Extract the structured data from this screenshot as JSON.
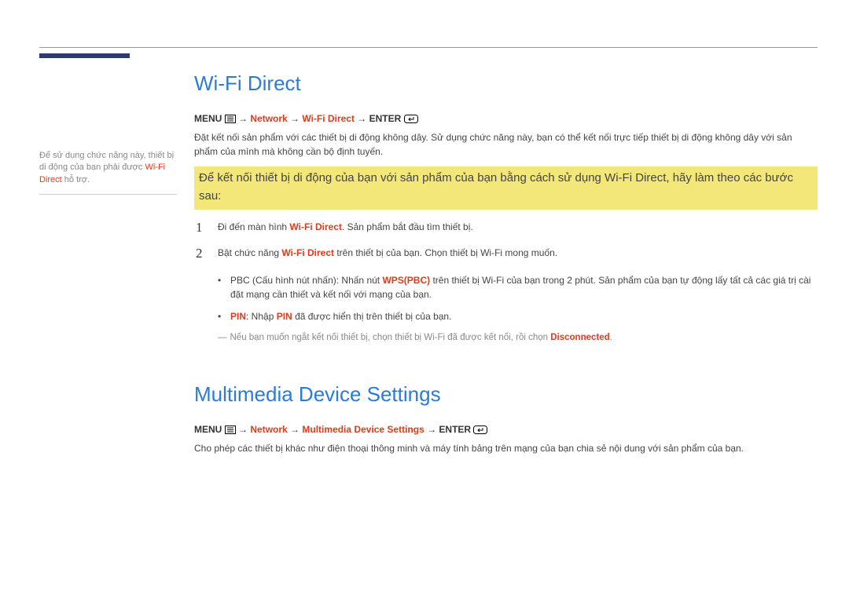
{
  "sidebar": {
    "note_pre": "Để sử dụng chức năng này, thiết bị di động của bạn phải được ",
    "note_hl": "Wi-Fi Direct",
    "note_post": " hỗ trợ."
  },
  "section1": {
    "title": "Wi-Fi Direct",
    "nav": {
      "menu": "MENU",
      "network": "Network",
      "item": "Wi-Fi Direct",
      "enter": "ENTER"
    },
    "intro": "Đặt kết nối sản phẩm với các thiết bị di động không dây. Sử dụng chức năng này, bạn có thể kết nối trực tiếp thiết bị di động không dây với sản phẩm của mình mà không cần bộ định tuyến.",
    "highlight": "Để kết nối thiết bị di động của bạn với sản phẩm của bạn bằng cách sử dụng Wi-Fi Direct, hãy làm theo các bước sau:",
    "step1_pre": "Đi đến màn hình ",
    "step1_hl": "Wi-Fi Direct",
    "step1_post": ". Sản phẩm bắt đầu tìm thiết bị.",
    "step2_pre": "Bật chức năng ",
    "step2_hl": "Wi-Fi Direct",
    "step2_post": " trên thiết bị của bạn. Chọn thiết bị Wi-Fi mong muốn.",
    "bullet1_pre": "PBC (Cấu hình nút nhấn): Nhấn nút ",
    "bullet1_hl": "WPS(PBC)",
    "bullet1_post": " trên thiết bị Wi-Fi của bạn trong 2 phút. Sản phẩm của bạn tự động lấy tất cả các giá trị cài đặt mạng cần thiết và kết nối với mạng của bạn.",
    "bullet2_hl1": "PIN",
    "bullet2_mid": ": Nhập ",
    "bullet2_hl2": "PIN",
    "bullet2_post": " đã được hiển thị trên thiết bị của bạn.",
    "footnote_pre": "Nếu bạn muốn ngắt kết nối thiết bị, chọn thiết bị Wi-Fi đã được kết nối, rồi chọn ",
    "footnote_hl": "Disconnected",
    "footnote_post": "."
  },
  "section2": {
    "title": "Multimedia Device Settings",
    "nav": {
      "menu": "MENU",
      "network": "Network",
      "item": "Multimedia Device Settings",
      "enter": "ENTER"
    },
    "body": "Cho phép các thiết bị khác như điện thoại thông minh và máy tính bảng trên mạng của bạn chia sẻ nội dung với sản phẩm của bạn."
  }
}
